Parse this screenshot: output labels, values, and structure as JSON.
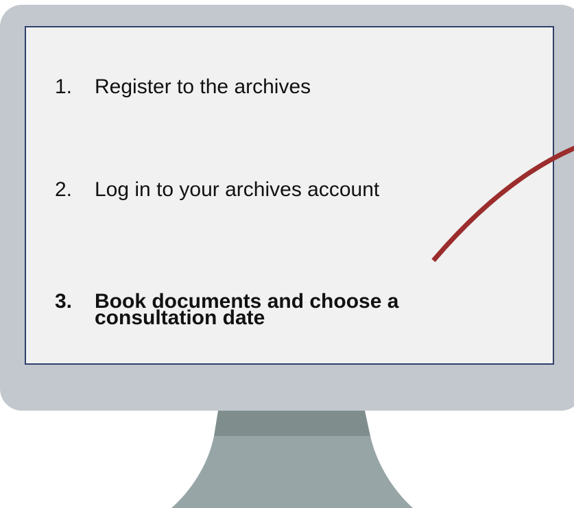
{
  "steps": [
    {
      "number": "1.",
      "label": "Register to the archives",
      "emphasis": false
    },
    {
      "number": "2.",
      "label": "Log in to your archives account",
      "emphasis": false
    },
    {
      "number": "3.",
      "label": "Book documents and choose a consultation date",
      "emphasis": true
    }
  ],
  "colors": {
    "bezel": "#c2c8ce",
    "screen": "#f1f1f1",
    "screen_border": "#2e3f6a",
    "stand_top": "#7f8e8c",
    "stand_body": "#97a5a7",
    "pointer_line": "#9b2d2d"
  }
}
